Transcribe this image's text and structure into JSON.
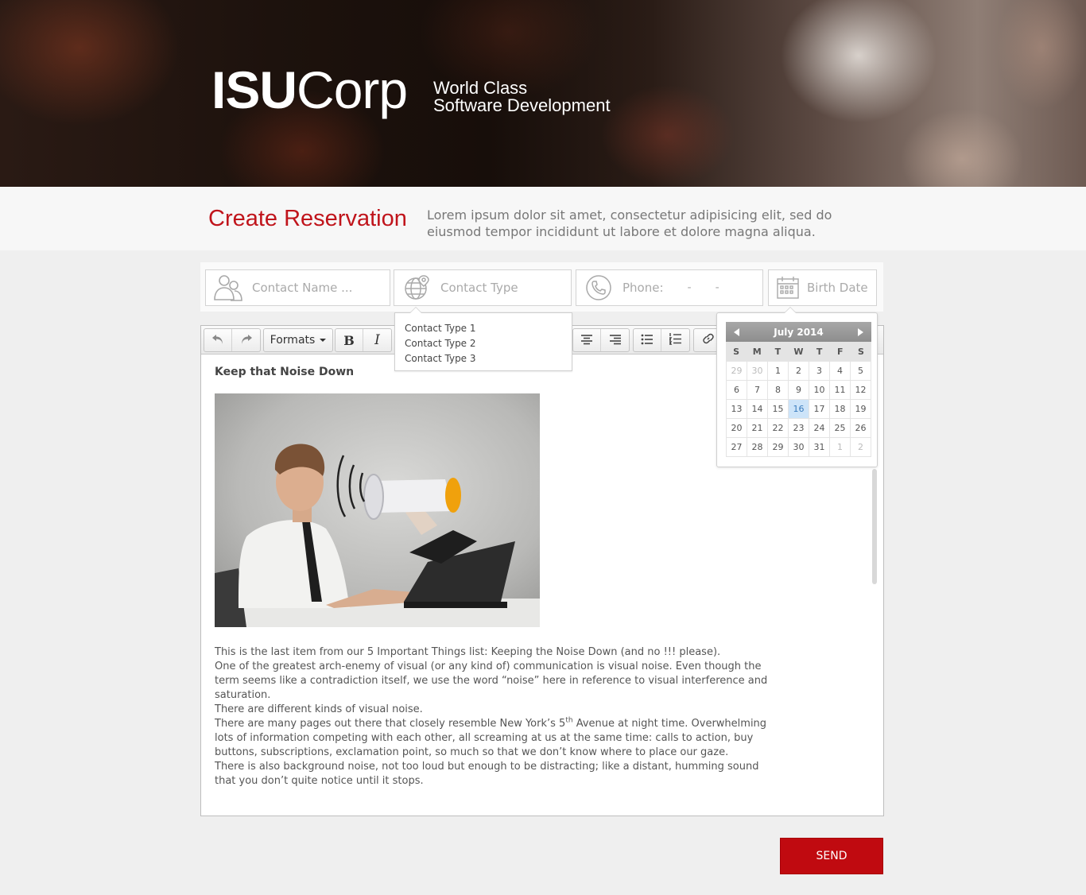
{
  "brand": {
    "logo_bold": "ISU",
    "logo_light": "Corp",
    "tagline_line1": "World Class",
    "tagline_line2": "Software Development"
  },
  "header": {
    "title": "Create Reservation",
    "description": "Lorem ipsum dolor sit amet, consectetur adipisicing elit, sed do eiusmod tempor incididunt ut labore et dolore magna aliqua."
  },
  "fields": {
    "contact_name": {
      "placeholder": "Contact Name ...",
      "icon": "user-group-icon"
    },
    "contact_type": {
      "placeholder": "Contact Type",
      "icon": "globe-pin-icon"
    },
    "phone": {
      "label": "Phone:",
      "sep1": "-",
      "sep2": "-",
      "icon": "phone-icon"
    },
    "birth_date": {
      "placeholder": "Birth Date",
      "icon": "calendar-icon"
    }
  },
  "contact_type_options": [
    "Contact Type 1",
    "Contact Type 2",
    "Contact Type 3"
  ],
  "toolbar": {
    "formats_label": "Formats",
    "bold_label": "B",
    "italic_label": "I",
    "icons": [
      "undo-icon",
      "redo-icon",
      "align-center-icon",
      "align-right-icon",
      "bullet-list-icon",
      "numbered-list-icon",
      "link-icon"
    ]
  },
  "article": {
    "title": "Keep that Noise Down",
    "p1": "This is the last item from our 5 Important Things list: Keeping the Noise Down (and no !!! please).",
    "p2": "One of the greatest arch-enemy of visual (or any kind of) communication is visual noise. Even though the term seems like a contradiction itself, we use the word “noise” here in reference to visual interference and saturation.",
    "p3": "There are different kinds of visual noise.",
    "p4_a": "There are many pages out there that closely resemble New York’s 5",
    "p4_sup": "th",
    "p4_b": " Avenue at night time. Overwhelming lots of information competing with each other, all screaming at us at the same time: calls to action, buy buttons, subscriptions, exclamation point, so much so that we don’t know where to place our gaze.",
    "p5": "There is also background noise, not too loud but enough to be distracting; like a distant, humming sound that you don’t quite notice until it stops."
  },
  "calendar": {
    "month_label": "July 2014",
    "weekdays": [
      "S",
      "M",
      "T",
      "W",
      "T",
      "F",
      "S"
    ],
    "selected_day": "16",
    "weeks": [
      [
        "29",
        "30",
        "1",
        "2",
        "3",
        "4",
        "5"
      ],
      [
        "6",
        "7",
        "8",
        "9",
        "10",
        "11",
        "12"
      ],
      [
        "13",
        "14",
        "15",
        "16",
        "17",
        "18",
        "19"
      ],
      [
        "20",
        "21",
        "22",
        "23",
        "24",
        "25",
        "26"
      ],
      [
        "27",
        "28",
        "29",
        "30",
        "31",
        "1",
        "2"
      ]
    ],
    "muted": [
      [
        0,
        0
      ],
      [
        0,
        1
      ],
      [
        4,
        5
      ],
      [
        4,
        6
      ]
    ]
  },
  "send_label": "SEND",
  "colors": {
    "accent": "#c0141b",
    "send_bg": "#c00a10",
    "selected_day_bg": "#cde4f9"
  }
}
